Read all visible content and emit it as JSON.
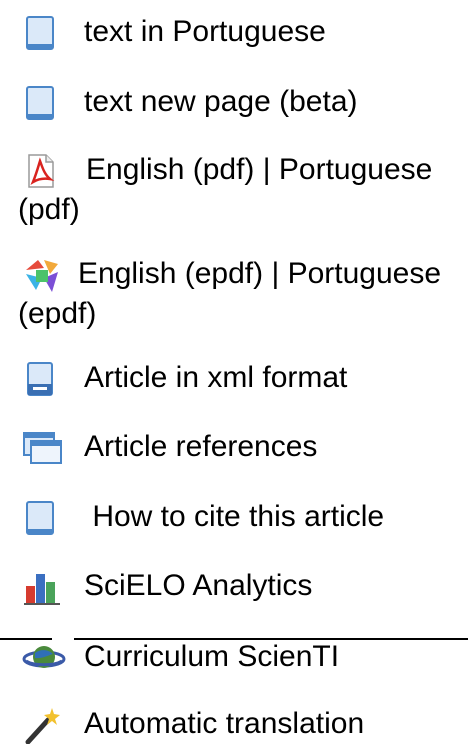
{
  "links": {
    "text_pt": "text in Portuguese",
    "text_new": "text new page (beta)",
    "pdf_en": "English (pdf)",
    "pdf_sep": " | ",
    "pdf_pt": "Portuguese (pdf)",
    "epdf_en": "English (epdf)",
    "epdf_sep": " | ",
    "epdf_pt": "Portuguese (epdf)",
    "xml": "Article in xml format",
    "refs": "Article references",
    "cite": " How to cite this article",
    "analytics": "SciELO Analytics",
    "curriculum": "Curriculum ScienTI",
    "translation": "Automatic translation"
  },
  "icons": {
    "text_pt": "document-icon",
    "text_new": "document-icon",
    "pdf": "pdf-icon",
    "epdf": "epdf-icon",
    "xml": "xml-document-icon",
    "refs": "windows-icon",
    "cite": "document-icon",
    "analytics": "bar-chart-icon",
    "curriculum": "globe-icon",
    "translation": "magic-wand-icon"
  },
  "colors": {
    "doc_fill": "#dbe9f9",
    "doc_stroke": "#4a86c8",
    "pdf_red": "#d9231f",
    "bar_red": "#d63b2f",
    "bar_blue": "#3b6fc1",
    "bar_green": "#4aa35a"
  }
}
